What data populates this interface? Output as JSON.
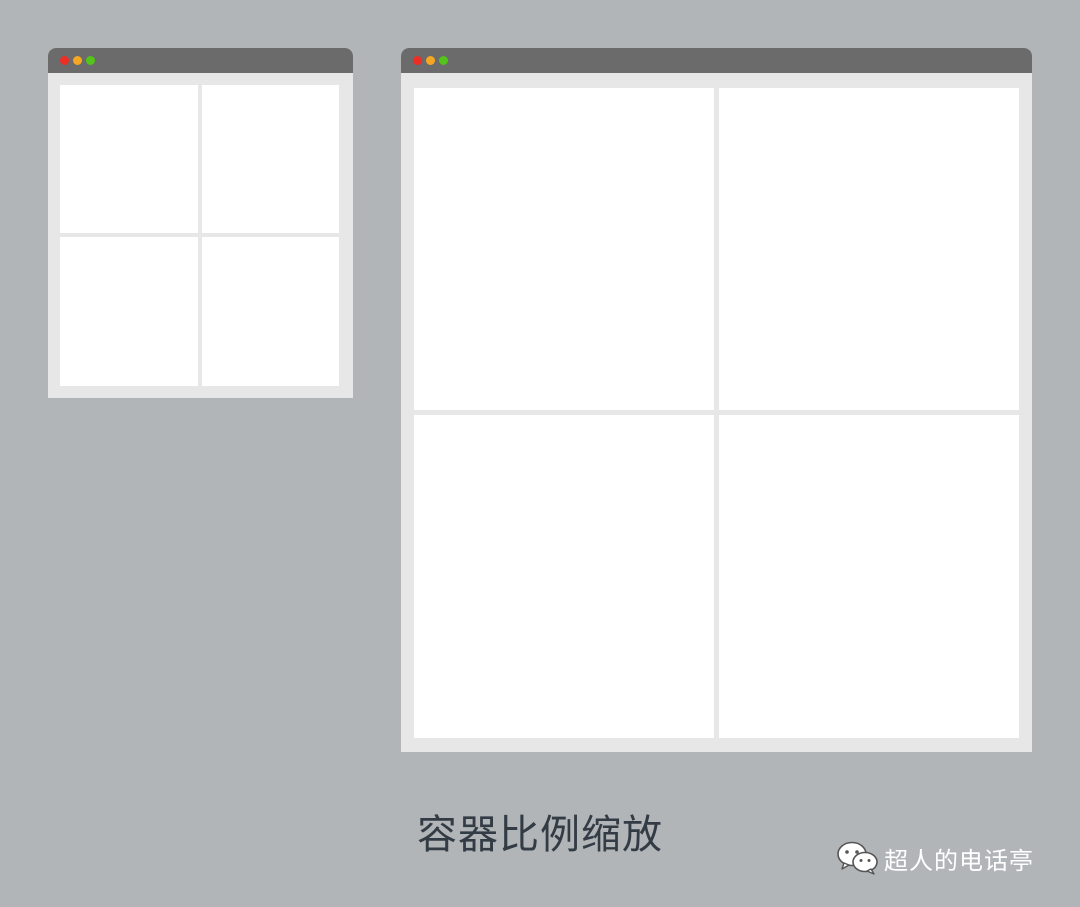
{
  "colors": {
    "background": "#b1b5b8",
    "window_frame": "#e6e7e6",
    "titlebar": "#6b6b6b",
    "panel": "#ffffff",
    "close_dot": "#ee2d24",
    "minimize_dot": "#f5a623",
    "maximize_dot": "#52c41a",
    "caption_text": "#333b44",
    "watermark_text": "#ffffff"
  },
  "windows": [
    {
      "name": "small-window",
      "panels": 4
    },
    {
      "name": "large-window",
      "panels": 4
    }
  ],
  "caption": "容器比例缩放",
  "watermark": {
    "icon": "wechat-icon",
    "text": "超人的电话亭"
  }
}
